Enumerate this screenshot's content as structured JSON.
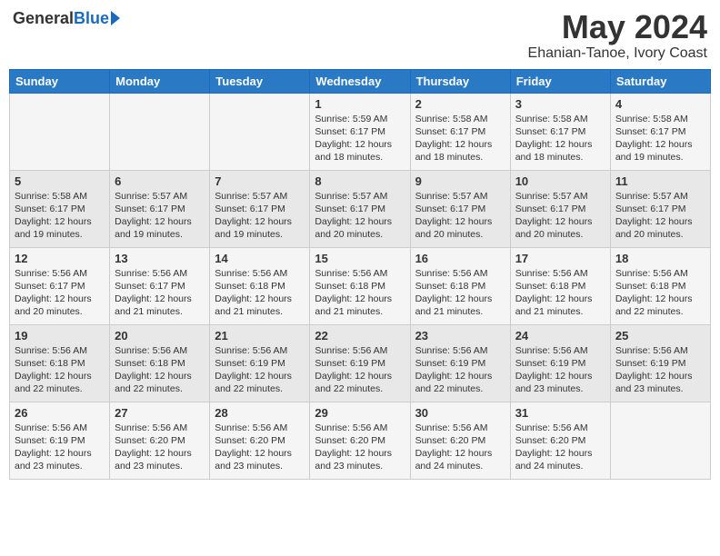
{
  "header": {
    "logo_general": "General",
    "logo_blue": "Blue",
    "month_title": "May 2024",
    "location": "Ehanian-Tanoe, Ivory Coast"
  },
  "days_of_week": [
    "Sunday",
    "Monday",
    "Tuesday",
    "Wednesday",
    "Thursday",
    "Friday",
    "Saturday"
  ],
  "weeks": [
    [
      {
        "day": "",
        "sunrise": "",
        "sunset": "",
        "daylight": ""
      },
      {
        "day": "",
        "sunrise": "",
        "sunset": "",
        "daylight": ""
      },
      {
        "day": "",
        "sunrise": "",
        "sunset": "",
        "daylight": ""
      },
      {
        "day": "1",
        "sunrise": "Sunrise: 5:59 AM",
        "sunset": "Sunset: 6:17 PM",
        "daylight": "Daylight: 12 hours and 18 minutes."
      },
      {
        "day": "2",
        "sunrise": "Sunrise: 5:58 AM",
        "sunset": "Sunset: 6:17 PM",
        "daylight": "Daylight: 12 hours and 18 minutes."
      },
      {
        "day": "3",
        "sunrise": "Sunrise: 5:58 AM",
        "sunset": "Sunset: 6:17 PM",
        "daylight": "Daylight: 12 hours and 18 minutes."
      },
      {
        "day": "4",
        "sunrise": "Sunrise: 5:58 AM",
        "sunset": "Sunset: 6:17 PM",
        "daylight": "Daylight: 12 hours and 19 minutes."
      }
    ],
    [
      {
        "day": "5",
        "sunrise": "Sunrise: 5:58 AM",
        "sunset": "Sunset: 6:17 PM",
        "daylight": "Daylight: 12 hours and 19 minutes."
      },
      {
        "day": "6",
        "sunrise": "Sunrise: 5:57 AM",
        "sunset": "Sunset: 6:17 PM",
        "daylight": "Daylight: 12 hours and 19 minutes."
      },
      {
        "day": "7",
        "sunrise": "Sunrise: 5:57 AM",
        "sunset": "Sunset: 6:17 PM",
        "daylight": "Daylight: 12 hours and 19 minutes."
      },
      {
        "day": "8",
        "sunrise": "Sunrise: 5:57 AM",
        "sunset": "Sunset: 6:17 PM",
        "daylight": "Daylight: 12 hours and 20 minutes."
      },
      {
        "day": "9",
        "sunrise": "Sunrise: 5:57 AM",
        "sunset": "Sunset: 6:17 PM",
        "daylight": "Daylight: 12 hours and 20 minutes."
      },
      {
        "day": "10",
        "sunrise": "Sunrise: 5:57 AM",
        "sunset": "Sunset: 6:17 PM",
        "daylight": "Daylight: 12 hours and 20 minutes."
      },
      {
        "day": "11",
        "sunrise": "Sunrise: 5:57 AM",
        "sunset": "Sunset: 6:17 PM",
        "daylight": "Daylight: 12 hours and 20 minutes."
      }
    ],
    [
      {
        "day": "12",
        "sunrise": "Sunrise: 5:56 AM",
        "sunset": "Sunset: 6:17 PM",
        "daylight": "Daylight: 12 hours and 20 minutes."
      },
      {
        "day": "13",
        "sunrise": "Sunrise: 5:56 AM",
        "sunset": "Sunset: 6:17 PM",
        "daylight": "Daylight: 12 hours and 21 minutes."
      },
      {
        "day": "14",
        "sunrise": "Sunrise: 5:56 AM",
        "sunset": "Sunset: 6:18 PM",
        "daylight": "Daylight: 12 hours and 21 minutes."
      },
      {
        "day": "15",
        "sunrise": "Sunrise: 5:56 AM",
        "sunset": "Sunset: 6:18 PM",
        "daylight": "Daylight: 12 hours and 21 minutes."
      },
      {
        "day": "16",
        "sunrise": "Sunrise: 5:56 AM",
        "sunset": "Sunset: 6:18 PM",
        "daylight": "Daylight: 12 hours and 21 minutes."
      },
      {
        "day": "17",
        "sunrise": "Sunrise: 5:56 AM",
        "sunset": "Sunset: 6:18 PM",
        "daylight": "Daylight: 12 hours and 21 minutes."
      },
      {
        "day": "18",
        "sunrise": "Sunrise: 5:56 AM",
        "sunset": "Sunset: 6:18 PM",
        "daylight": "Daylight: 12 hours and 22 minutes."
      }
    ],
    [
      {
        "day": "19",
        "sunrise": "Sunrise: 5:56 AM",
        "sunset": "Sunset: 6:18 PM",
        "daylight": "Daylight: 12 hours and 22 minutes."
      },
      {
        "day": "20",
        "sunrise": "Sunrise: 5:56 AM",
        "sunset": "Sunset: 6:18 PM",
        "daylight": "Daylight: 12 hours and 22 minutes."
      },
      {
        "day": "21",
        "sunrise": "Sunrise: 5:56 AM",
        "sunset": "Sunset: 6:19 PM",
        "daylight": "Daylight: 12 hours and 22 minutes."
      },
      {
        "day": "22",
        "sunrise": "Sunrise: 5:56 AM",
        "sunset": "Sunset: 6:19 PM",
        "daylight": "Daylight: 12 hours and 22 minutes."
      },
      {
        "day": "23",
        "sunrise": "Sunrise: 5:56 AM",
        "sunset": "Sunset: 6:19 PM",
        "daylight": "Daylight: 12 hours and 22 minutes."
      },
      {
        "day": "24",
        "sunrise": "Sunrise: 5:56 AM",
        "sunset": "Sunset: 6:19 PM",
        "daylight": "Daylight: 12 hours and 23 minutes."
      },
      {
        "day": "25",
        "sunrise": "Sunrise: 5:56 AM",
        "sunset": "Sunset: 6:19 PM",
        "daylight": "Daylight: 12 hours and 23 minutes."
      }
    ],
    [
      {
        "day": "26",
        "sunrise": "Sunrise: 5:56 AM",
        "sunset": "Sunset: 6:19 PM",
        "daylight": "Daylight: 12 hours and 23 minutes."
      },
      {
        "day": "27",
        "sunrise": "Sunrise: 5:56 AM",
        "sunset": "Sunset: 6:20 PM",
        "daylight": "Daylight: 12 hours and 23 minutes."
      },
      {
        "day": "28",
        "sunrise": "Sunrise: 5:56 AM",
        "sunset": "Sunset: 6:20 PM",
        "daylight": "Daylight: 12 hours and 23 minutes."
      },
      {
        "day": "29",
        "sunrise": "Sunrise: 5:56 AM",
        "sunset": "Sunset: 6:20 PM",
        "daylight": "Daylight: 12 hours and 23 minutes."
      },
      {
        "day": "30",
        "sunrise": "Sunrise: 5:56 AM",
        "sunset": "Sunset: 6:20 PM",
        "daylight": "Daylight: 12 hours and 24 minutes."
      },
      {
        "day": "31",
        "sunrise": "Sunrise: 5:56 AM",
        "sunset": "Sunset: 6:20 PM",
        "daylight": "Daylight: 12 hours and 24 minutes."
      },
      {
        "day": "",
        "sunrise": "",
        "sunset": "",
        "daylight": ""
      }
    ]
  ]
}
